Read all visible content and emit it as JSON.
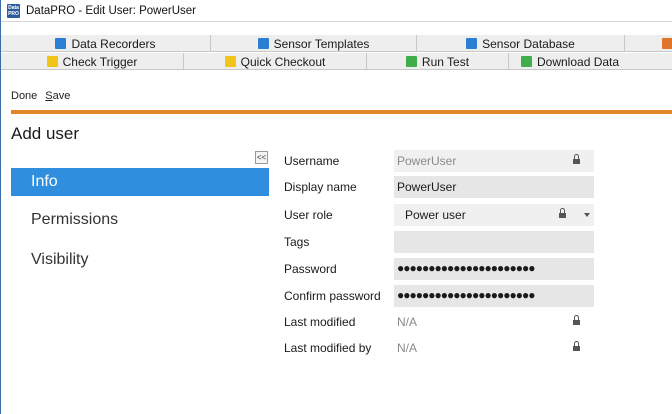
{
  "window": {
    "title": "DataPRO - Edit User: PowerUser",
    "app_icon_text": "Data PRO"
  },
  "tabs_row1": [
    {
      "label": "Data Recorders",
      "icon": "data-recorders-icon",
      "color": "#2a7fd4"
    },
    {
      "label": "Sensor Templates",
      "icon": "sensor-templates-icon",
      "color": "#2a7fd4"
    },
    {
      "label": "Sensor Database",
      "icon": "sensor-database-icon",
      "color": "#2a7fd4"
    },
    {
      "label": "",
      "icon": "truncated-tab-icon",
      "color": "#e0742a"
    }
  ],
  "tabs_row2": [
    {
      "label": "Check Trigger",
      "icon": "check-trigger-icon",
      "color": "#f0c419"
    },
    {
      "label": "Quick Checkout",
      "icon": "quick-checkout-icon",
      "color": "#f0c419"
    },
    {
      "label": "Run Test",
      "icon": "run-test-icon",
      "color": "#3fae4a"
    },
    {
      "label": "Download Data",
      "icon": "download-data-icon",
      "color": "#3fae4a"
    }
  ],
  "toolbar": {
    "done_label": "Done",
    "save_label": "Save"
  },
  "colors": {
    "accent": "#e0872a",
    "nav_active": "#2f8fde"
  },
  "page": {
    "title": "Add user",
    "collapse_label": "<<"
  },
  "nav": {
    "items": [
      {
        "label": "Info",
        "active": true
      },
      {
        "label": "Permissions",
        "active": false
      },
      {
        "label": "Visibility",
        "active": false
      }
    ]
  },
  "form": {
    "username": {
      "label": "Username",
      "value": "PowerUser",
      "locked": true
    },
    "display_name": {
      "label": "Display name",
      "value": "PowerUser"
    },
    "user_role": {
      "label": "User role",
      "value": "Power user",
      "locked": true
    },
    "tags": {
      "label": "Tags",
      "value": ""
    },
    "password": {
      "label": "Password",
      "value": "●●●●●●●●●●●●●●●●●●●●●●"
    },
    "confirm_password": {
      "label": "Confirm password",
      "value": "●●●●●●●●●●●●●●●●●●●●●●"
    },
    "last_modified": {
      "label": "Last modified",
      "value": "N/A",
      "locked": true
    },
    "last_modified_by": {
      "label": "Last modified by",
      "value": "N/A",
      "locked": true
    }
  }
}
